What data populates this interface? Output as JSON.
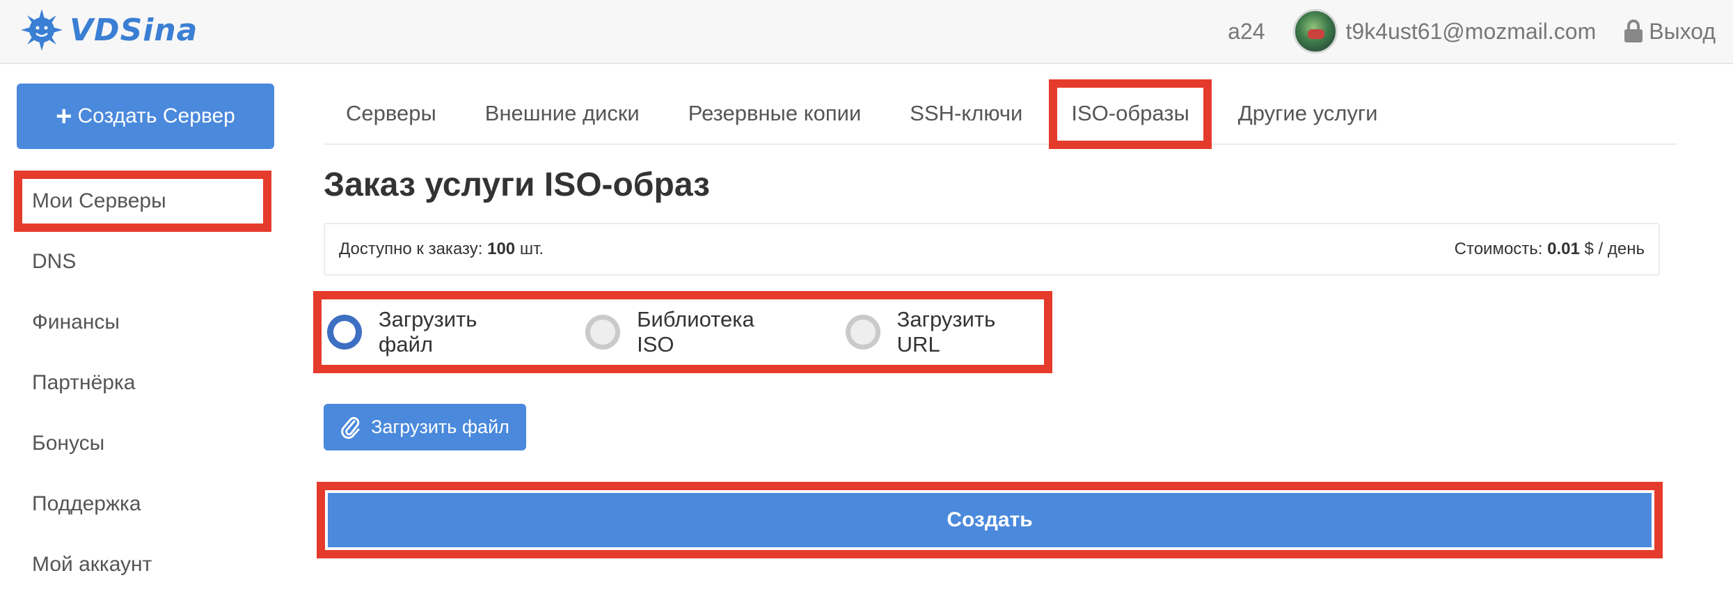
{
  "header": {
    "logo_text": "VDSina",
    "account_code": "a24",
    "email": "t9k4ust61@mozmail.com",
    "logout_label": "Выход"
  },
  "sidebar": {
    "create_label": "Создать Сервер",
    "items": [
      {
        "label": "Мои Серверы",
        "highlighted": true
      },
      {
        "label": "DNS"
      },
      {
        "label": "Финансы"
      },
      {
        "label": "Партнёрка"
      },
      {
        "label": "Бонусы"
      },
      {
        "label": "Поддержка"
      },
      {
        "label": "Мой аккаунт"
      }
    ]
  },
  "tabs": [
    {
      "label": "Серверы"
    },
    {
      "label": "Внешние диски"
    },
    {
      "label": "Резервные копии"
    },
    {
      "label": "SSH-ключи"
    },
    {
      "label": "ISO-образы",
      "active": true
    },
    {
      "label": "Другие услуги"
    }
  ],
  "page": {
    "title": "Заказ услуги ISO-образ",
    "available_label": "Доступно к заказу:",
    "available_value": "100",
    "available_unit": "шт.",
    "cost_label": "Стоимость:",
    "cost_value": "0.01",
    "cost_unit": "$ / день"
  },
  "source_options": [
    {
      "label": "Загрузить файл",
      "selected": true
    },
    {
      "label": "Библиотека ISO",
      "selected": false
    },
    {
      "label": "Загрузить URL",
      "selected": false
    }
  ],
  "upload_button_label": "Загрузить файл",
  "submit_label": "Создать",
  "colors": {
    "accent": "#4a89dc",
    "highlight": "#e53b2c",
    "radio_selected": "#3d6fc2"
  }
}
